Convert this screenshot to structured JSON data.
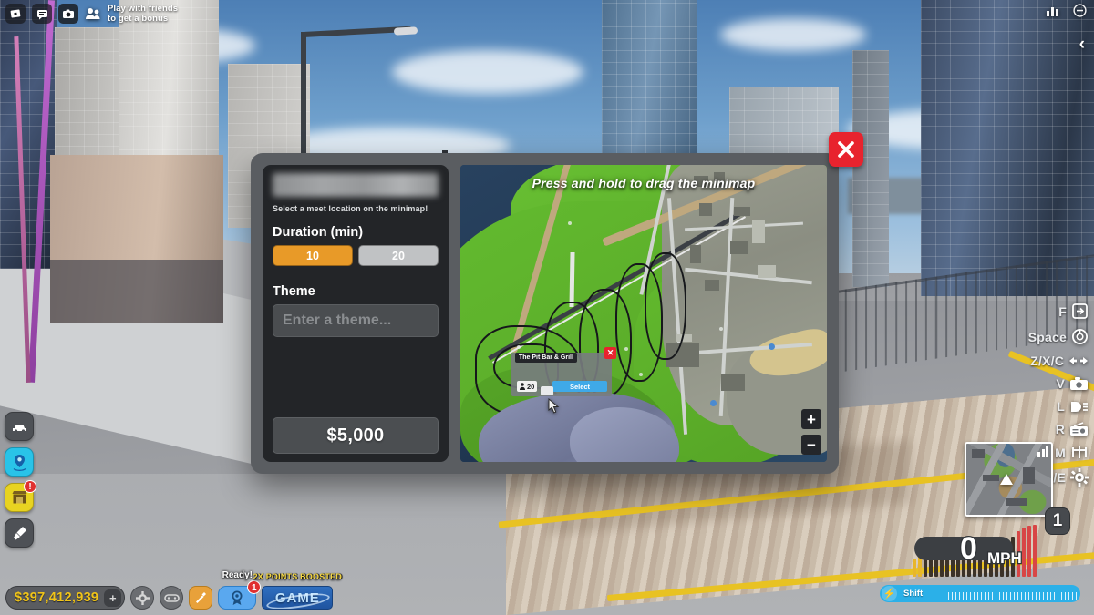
{
  "roblox_topbar": {
    "left_icons": [
      "roblox-logo-icon",
      "chat-icon",
      "camera-icon"
    ],
    "friends_prompt_line1": "Play with friends",
    "friends_prompt_line2": "to get a bonus",
    "right_icons": [
      "signal-bars-icon",
      "minus-circle-icon"
    ],
    "collapse_chevron": "‹"
  },
  "left_rail": {
    "items": [
      {
        "name": "vehicle-garage",
        "icon": "car-icon",
        "color": "#4e5156",
        "badge": ""
      },
      {
        "name": "teleport-locations",
        "icon": "location-pin-icon",
        "color": "#29c3e8",
        "badge": ""
      },
      {
        "name": "dealership-shop",
        "icon": "shop-icon",
        "color": "#e8d321",
        "badge": "!"
      },
      {
        "name": "customization-paint",
        "icon": "paintbrush-icon",
        "color": "#4e5156",
        "badge": ""
      }
    ]
  },
  "bottom_hud": {
    "money": "$397,412,939",
    "money_add_label": "+",
    "settings_icon": "gear-icon",
    "controller_icon": "gamepad-icon",
    "tools_icon": "wrench-icon",
    "ready_label": "Ready!",
    "ready_icon": "award-ribbon-icon",
    "ready_badge": "1",
    "boost_label": "2X POINTS BOOSTED",
    "boost_tile_text": "GAME"
  },
  "keybinds": [
    {
      "key": "F",
      "icon": "enter-door-icon"
    },
    {
      "key": "Space",
      "icon": "handbrake-icon"
    },
    {
      "key": "Z/X/C",
      "icon": "look-left-right-icon"
    },
    {
      "key": "V",
      "icon": "camera-icon"
    },
    {
      "key": "L",
      "icon": "headlights-icon"
    },
    {
      "key": "R",
      "icon": "radio-icon"
    },
    {
      "key": "M",
      "icon": "map-icon"
    },
    {
      "key": "Q/E",
      "icon": "gear-settings-icon"
    }
  ],
  "minimap": {
    "name": "minimap",
    "player_marker": "player-arrow-icon"
  },
  "gear_indicator": "1",
  "speedometer": {
    "value": "0",
    "unit": "MPH",
    "boost_key_label": "Shift",
    "boost_icon": "lightning-bolt-icon",
    "tick_colors": {
      "low": "#e8b62a",
      "mid": "#3c3228",
      "high": "#d84646"
    }
  },
  "dialog": {
    "name": "create-meet-dialog",
    "title_redacted": true,
    "subtitle": "Select a meet location on the minimap!",
    "duration_label": "Duration (min)",
    "duration_options": [
      {
        "value": "10",
        "selected": true
      },
      {
        "value": "20",
        "selected": false
      }
    ],
    "theme_label": "Theme",
    "theme_value": "",
    "theme_placeholder": "Enter a theme...",
    "price_label": "$5,000",
    "close_label": "✕",
    "colors": {
      "accent_orange": "#e89a28",
      "idle_gray": "#c0c2c4",
      "close_red": "#e8232e",
      "panel_dark": "#232528",
      "frame_gray": "#5a5d61"
    }
  },
  "map": {
    "hint": "Press and hold to drag the minimap",
    "zoom_in_label": "+",
    "zoom_out_label": "−",
    "poi": {
      "name": "The Pit Bar & Grill",
      "player_count": "20",
      "select_label": "Select",
      "remove_label": "✕",
      "player_icon": "person-icon"
    }
  }
}
